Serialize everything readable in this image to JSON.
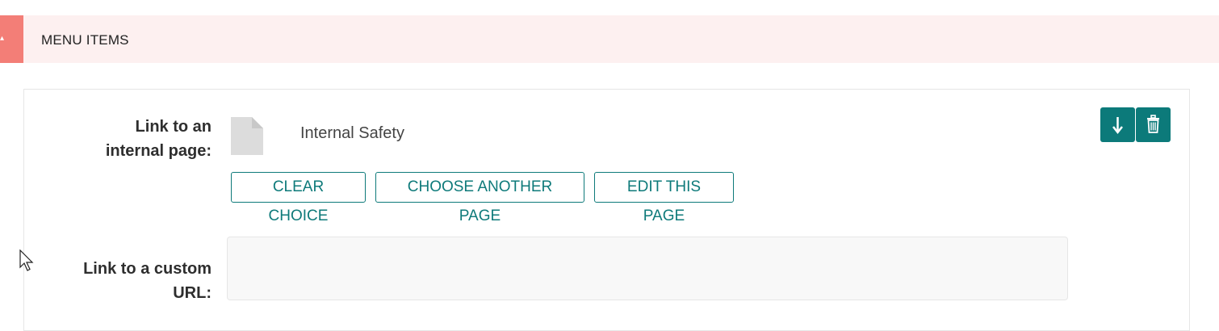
{
  "section": {
    "title": "MENU ITEMS"
  },
  "fields": {
    "internal_page": {
      "label": "Link to an internal page:",
      "label_line1": "Link to an",
      "label_line2": "internal page:",
      "selected_page_title": "Internal Safety"
    },
    "custom_url": {
      "label_line1": "Link to a custom",
      "label_line2": "URL:",
      "value": ""
    }
  },
  "buttons": {
    "clear_choice": "CLEAR CHOICE",
    "choose_another_page": "CHOOSE ANOTHER PAGE",
    "edit_this_page": "EDIT THIS PAGE"
  },
  "icons": {
    "move_down": "arrow-down-icon",
    "delete": "trash-icon",
    "document": "document-icon",
    "collapse": "caret-icon"
  },
  "colors": {
    "accent": "#0c7a7a",
    "header_bg": "#fdf0f0",
    "header_tab": "#f37e77"
  }
}
